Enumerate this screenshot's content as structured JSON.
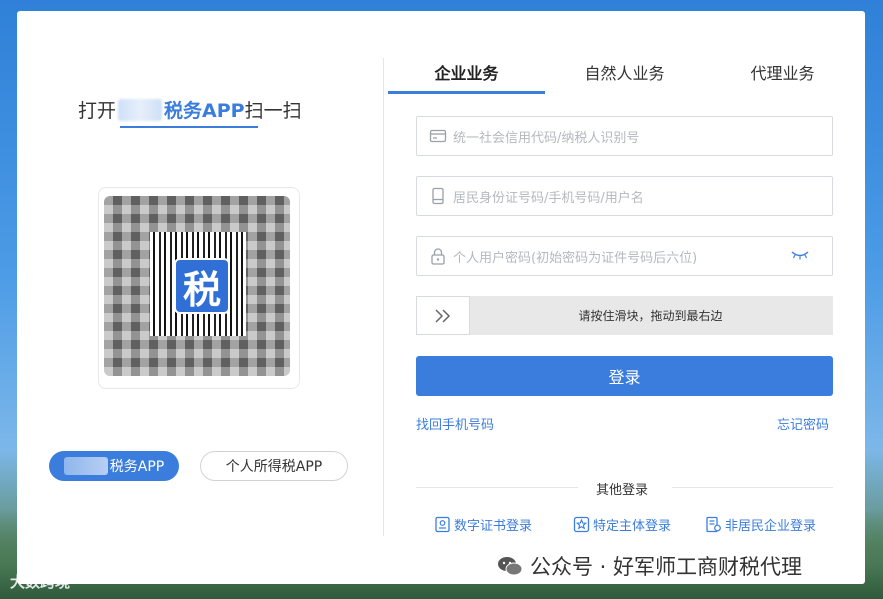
{
  "left": {
    "scan_prefix": "打开",
    "scan_brand": "税务APP",
    "scan_suffix": "扫一扫",
    "qr_logo_char": "税",
    "app_button_1": "税务APP",
    "app_button_2": "个人所得税APP"
  },
  "tabs": [
    {
      "label": "企业业务",
      "active": true
    },
    {
      "label": "自然人业务",
      "active": false
    },
    {
      "label": "代理业务",
      "active": false
    }
  ],
  "form": {
    "credit_code_placeholder": "统一社会信用代码/纳税人识别号",
    "id_placeholder": "居民身份证号码/手机号码/用户名",
    "password_placeholder": "个人用户密码(初始密码为证件号码后六位)",
    "slider_hint": "请按住滑块，拖动到最右边",
    "login_label": "登录",
    "recover_phone": "找回手机号码",
    "forgot_password": "忘记密码"
  },
  "other_login": {
    "title": "其他登录",
    "items": [
      {
        "label": "数字证书登录",
        "icon": "certificate-icon"
      },
      {
        "label": "特定主体登录",
        "icon": "star-badge-icon"
      },
      {
        "label": "非居民企业登录",
        "icon": "enterprise-doc-icon"
      }
    ]
  },
  "watermark": "公众号 · 好军师工商财税代理",
  "corner_watermark": "大数跨境",
  "colors": {
    "accent": "#3b7ddd",
    "placeholder": "#b4b8bf"
  }
}
